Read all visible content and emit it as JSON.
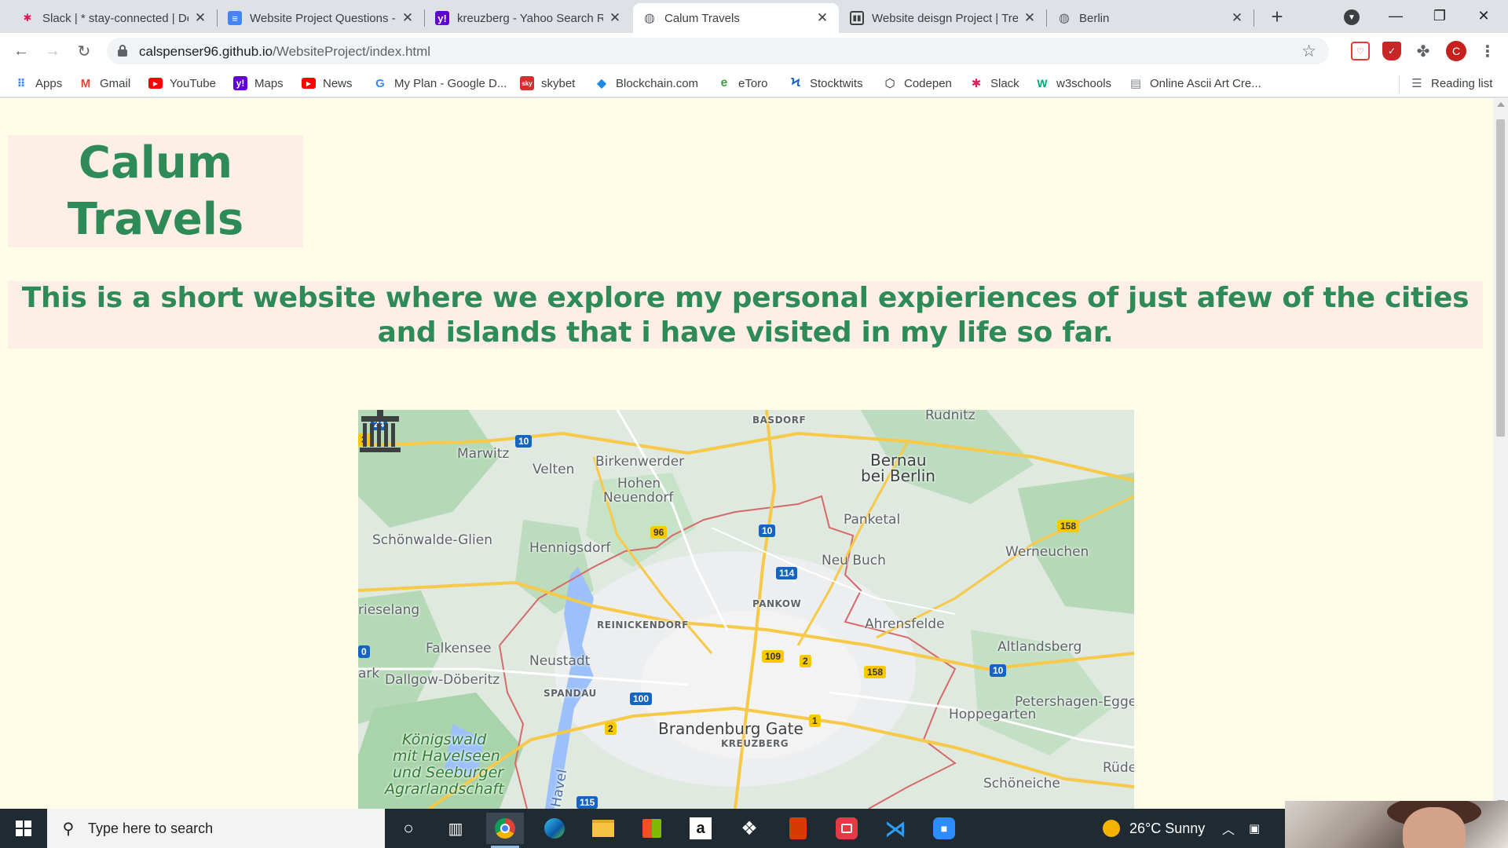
{
  "browser": {
    "tabs": [
      {
        "title": "Slack | * stay-connected | De",
        "icon": "slack-icon",
        "active": false
      },
      {
        "title": "Website Project Questions -",
        "icon": "google-docs-icon",
        "active": false
      },
      {
        "title": "kreuzberg - Yahoo Search R",
        "icon": "yahoo-icon",
        "active": false
      },
      {
        "title": "Calum Travels",
        "icon": "globe-icon",
        "active": true
      },
      {
        "title": "Website deisgn Project | Tre",
        "icon": "trello-icon",
        "active": false
      },
      {
        "title": "Berlin",
        "icon": "globe-icon",
        "active": false
      }
    ],
    "new_tab": "+",
    "address": {
      "host": "calspenser96.github.io",
      "path": "/WebsiteProject/index.html"
    },
    "profile_initial": "C",
    "bookmarks": [
      {
        "label": "Apps",
        "icon": "apps-grid-icon"
      },
      {
        "label": "Gmail",
        "icon": "gmail-icon"
      },
      {
        "label": "YouTube",
        "icon": "youtube-icon"
      },
      {
        "label": "Maps",
        "icon": "yahoo-icon"
      },
      {
        "label": "News",
        "icon": "youtube-icon"
      },
      {
        "label": "My Plan - Google D...",
        "icon": "google-icon"
      },
      {
        "label": "skybet",
        "icon": "skybet-icon"
      },
      {
        "label": "Blockchain.com",
        "icon": "blockchain-icon"
      },
      {
        "label": "eToro",
        "icon": "etoro-icon"
      },
      {
        "label": "Stocktwits",
        "icon": "stocktwits-icon"
      },
      {
        "label": "Codepen",
        "icon": "codepen-icon"
      },
      {
        "label": "Slack",
        "icon": "slack-icon"
      },
      {
        "label": "w3schools",
        "icon": "w3schools-icon"
      },
      {
        "label": "Online Ascii Art Cre...",
        "icon": "document-icon"
      }
    ],
    "reading_list": "Reading list"
  },
  "page": {
    "title_line1": "Calum",
    "title_line2": "Travels",
    "intro": "This is a short website where we explore my personal expieriences of just afew of the cities and islands that i have visited in my life so far.",
    "map": {
      "places": [
        "BASDORF",
        "Rüdnitz",
        "Marwitz",
        "Velten",
        "Birkenwerder",
        "Hohen",
        "Neuendorf",
        "Bernau",
        "bei Berlin",
        "Panketal",
        "Schönwalde-Glien",
        "Hennigsdorf",
        "Neu Buch",
        "Werneuchen",
        "rieselang",
        "PANKOW",
        "REINICKENDORF",
        "Ahrensfelde",
        "Falkensee",
        "Altlandsberg",
        "Neustadt",
        "ark",
        "Dallgow-Döberitz",
        "SPANDAU",
        "Petershagen-Egge",
        "Hoppegarten",
        "Brandenburg Gate",
        "KREUZBERG",
        "Königswald",
        "mit Havelseen",
        "und Seeburger",
        "Agrarlandschaft",
        "Rüde",
        "Schöneiche",
        "Havel"
      ],
      "route_shields": [
        "24",
        "3",
        "10",
        "96",
        "10",
        "158",
        "114",
        "0",
        "109",
        "2",
        "158",
        "10",
        "100",
        "1",
        "2",
        "115"
      ]
    }
  },
  "taskbar": {
    "search_placeholder": "Type here to search",
    "weather": "26°C  Sunny"
  }
}
